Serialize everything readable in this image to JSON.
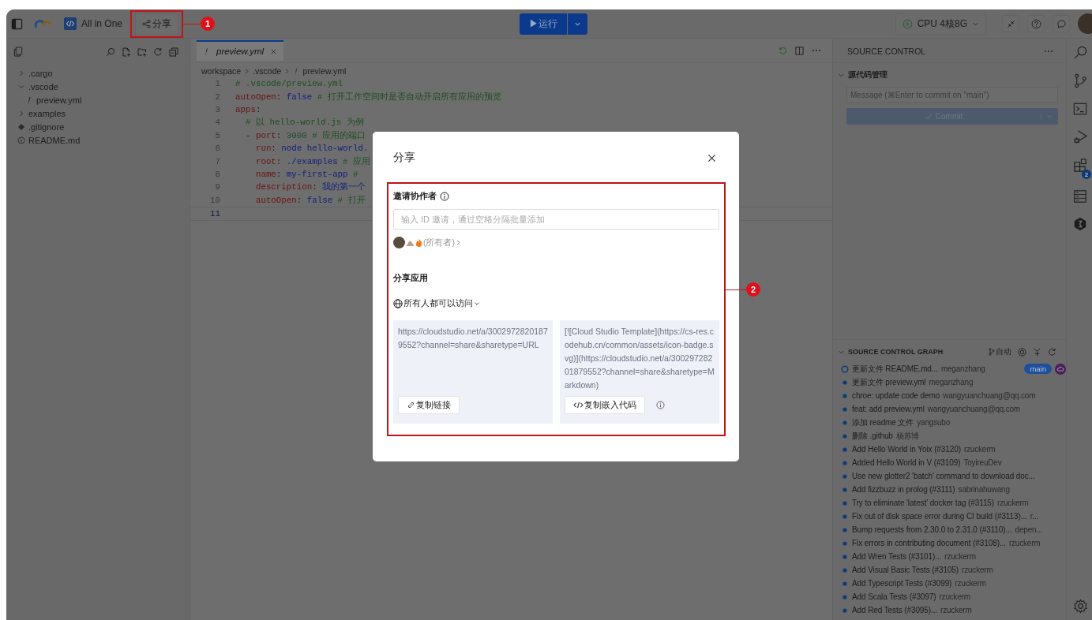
{
  "topbar": {
    "workspace_name": "All in One",
    "share_button": "分享",
    "run_button": "▶运行",
    "machine": "CPU 4核8G"
  },
  "annotations": [
    {
      "label": "1"
    },
    {
      "label": "2"
    }
  ],
  "explorer": {
    "items": [
      {
        "label": ".cargo",
        "kind": "folder",
        "expanded": false
      },
      {
        "label": ".vscode",
        "kind": "folder",
        "expanded": true,
        "children": [
          {
            "label": "preview.yml",
            "kind": "yaml"
          }
        ]
      },
      {
        "label": "examples",
        "kind": "folder",
        "expanded": false
      },
      {
        "label": ".gitignore",
        "kind": "git"
      },
      {
        "label": "README.md",
        "kind": "info"
      }
    ]
  },
  "editor": {
    "tabs": [
      {
        "label": "preview.yml",
        "selected": true
      }
    ],
    "breadcrumb": [
      "workspace",
      ".vscode",
      "preview.yml"
    ],
    "lines": [
      {
        "number": "1",
        "selected": false,
        "tokens": [
          {
            "kind": "comment",
            "text": "# .vscode/preview.yml"
          }
        ]
      },
      {
        "number": "2",
        "selected": false,
        "tokens": [
          {
            "kind": "key",
            "text": "autoOpen"
          },
          {
            "kind": "punct",
            "text": ": "
          },
          {
            "kind": "bool",
            "text": "false"
          },
          {
            "kind": "comment",
            "text": " # 打开工作空间时是否自动开启所有应用的预览"
          }
        ]
      },
      {
        "number": "3",
        "selected": false,
        "tokens": [
          {
            "kind": "key",
            "text": "apps"
          },
          {
            "kind": "punct",
            "text": ":"
          }
        ]
      },
      {
        "number": "4",
        "selected": false,
        "tokens": [
          {
            "kind": "comment",
            "text": "  # 以 hello-world.js 为例"
          }
        ]
      },
      {
        "number": "5",
        "selected": false,
        "tokens": [
          {
            "kind": "punct",
            "text": "  - "
          },
          {
            "kind": "key",
            "text": "port"
          },
          {
            "kind": "punct",
            "text": ": "
          },
          {
            "kind": "number",
            "text": "3000"
          },
          {
            "kind": "comment",
            "text": " # 应用的端口"
          }
        ]
      },
      {
        "number": "6",
        "selected": false,
        "tokens": [
          {
            "kind": "key",
            "text": "    run"
          },
          {
            "kind": "punct",
            "text": ": "
          },
          {
            "kind": "string",
            "text": "node hello-world."
          }
        ]
      },
      {
        "number": "7",
        "selected": false,
        "tokens": [
          {
            "kind": "key",
            "text": "    root"
          },
          {
            "kind": "punct",
            "text": ": "
          },
          {
            "kind": "string",
            "text": "./examples"
          },
          {
            "kind": "comment",
            "text": " # 应用"
          }
        ]
      },
      {
        "number": "8",
        "selected": false,
        "tokens": [
          {
            "kind": "key",
            "text": "    name"
          },
          {
            "kind": "punct",
            "text": ": "
          },
          {
            "kind": "string",
            "text": "my-first-app"
          },
          {
            "kind": "comment",
            "text": " #"
          }
        ]
      },
      {
        "number": "9",
        "selected": false,
        "tokens": [
          {
            "kind": "key",
            "text": "    description"
          },
          {
            "kind": "punct",
            "text": ": "
          },
          {
            "kind": "string",
            "text": "我的第一个"
          }
        ]
      },
      {
        "number": "10",
        "selected": false,
        "tokens": [
          {
            "kind": "key",
            "text": "    autoOpen"
          },
          {
            "kind": "punct",
            "text": ": "
          },
          {
            "kind": "bool",
            "text": "false"
          },
          {
            "kind": "comment",
            "text": " # 打开"
          }
        ]
      },
      {
        "number": "11",
        "selected": true
      }
    ]
  },
  "share_dialog": {
    "title": "分享",
    "invite_label": "邀请协作者",
    "invite_placeholder": "输入 ID 邀请，通过空格分隔批量添加",
    "owner_label": "(所有者)",
    "section_title": "分享应用",
    "access": "所有人都可以访问",
    "cards": [
      {
        "kind": "link",
        "text": "https://cloudstudio.net/a/30029728201879552?channel=share&sharetype=URL",
        "button": "复制链接",
        "info": false
      },
      {
        "kind": "embed",
        "text": "[![Cloud Studio Template](https://cs-res.codehub.cn/common/assets/icon-badge.svg)](https://cloudstudio.net/a/30029728201879552?channel=share&sharetype=Markdown)",
        "button": "复制嵌入代码",
        "info": true
      }
    ]
  },
  "source_control": {
    "title": "SOURCE CONTROL",
    "section": "源代码管理",
    "message_placeholder": "Message (⌘Enter to commit on \"main\")",
    "commit_button": "Commit",
    "commit_disabled": true
  },
  "graph": {
    "title": "SOURCE CONTROL GRAPH",
    "auto_label": "自动",
    "commits": [
      {
        "message": "更新文件 README.md...",
        "author": "meganzhang",
        "head": true,
        "branch": "main"
      },
      {
        "message": "更新文件 preview.yml",
        "author": "meganzhang",
        "head": false
      },
      {
        "message": "chroe: update code demo",
        "author": "wangyuanchuang@qq.com",
        "head": false
      },
      {
        "message": "feat: add preview.yml",
        "author": "wangyuanchuang@qq.com",
        "head": false
      },
      {
        "message": "添加 readme 文件",
        "author": "yangsubo",
        "head": false
      },
      {
        "message": "删除 .github",
        "author": "杨苏博",
        "head": false
      },
      {
        "message": "Add Hello World in Yoix (#3120)",
        "author": "rzuckerm",
        "head": false
      },
      {
        "message": "Added Hello World in V (#3109)",
        "author": "ToyireuDev",
        "head": false
      },
      {
        "message": "Use new glotter2 'batch' command to download doc...",
        "head": false
      },
      {
        "message": "Add fizzbuzz in prolog (#3111)",
        "author": "sabrinahuwang",
        "head": false
      },
      {
        "message": "Try to eliminate 'latest' docker tag (#3115)",
        "author": "rzuckerm",
        "head": false
      },
      {
        "message": "Fix out of disk space error during CI build (#3113)...",
        "author": "r...",
        "head": false
      },
      {
        "message": "Bump requests from 2.30.0 to 2.31.0 (#3110)...",
        "author": "depen...",
        "head": false
      },
      {
        "message": "Fix errors in contributing document (#3108)...",
        "author": "rzuckerm",
        "head": false
      },
      {
        "message": "Add Wren Tests (#3101)...",
        "author": "rzuckerm",
        "head": false
      },
      {
        "message": "Add Visual Basic Tests (#3105)",
        "author": "rzuckerm",
        "head": false
      },
      {
        "message": "Add Typescript Tests (#3099)",
        "author": "rzuckerm",
        "head": false
      },
      {
        "message": "Add Scala Tests (#3097)",
        "author": "rzuckerm",
        "head": false
      },
      {
        "message": "Add Red Tests (#3095)...",
        "author": "rzuckerm",
        "head": false
      }
    ]
  },
  "activity_bar": {
    "extensions_badge": "2"
  }
}
